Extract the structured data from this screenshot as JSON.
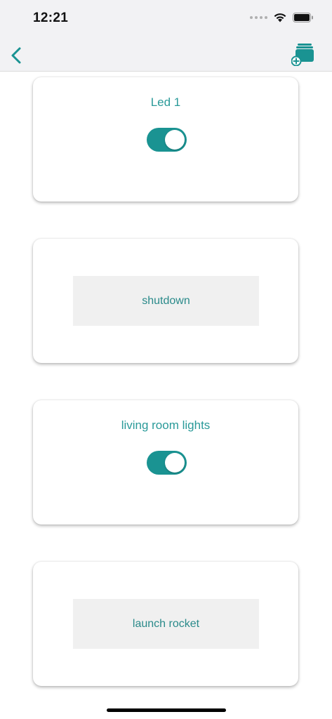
{
  "status_bar": {
    "time": "12:21",
    "icons": [
      "signal-dots-icon",
      "wifi-icon",
      "battery-icon"
    ]
  },
  "nav_bar": {
    "back_icon": "chevron-left-icon",
    "add_icon": "add-device-icon",
    "accent_color": "#1a9392"
  },
  "cards": [
    {
      "type": "toggle",
      "title": "Led 1",
      "on": true
    },
    {
      "type": "button",
      "label": "shutdown"
    },
    {
      "type": "toggle",
      "title": "living room lights",
      "on": true
    },
    {
      "type": "button",
      "label": "launch rocket"
    }
  ],
  "colors": {
    "accent": "#1a9392",
    "text_accent": "#2a9a99",
    "button_bg": "#f0f0f0",
    "bar_bg": "#f2f2f4"
  }
}
